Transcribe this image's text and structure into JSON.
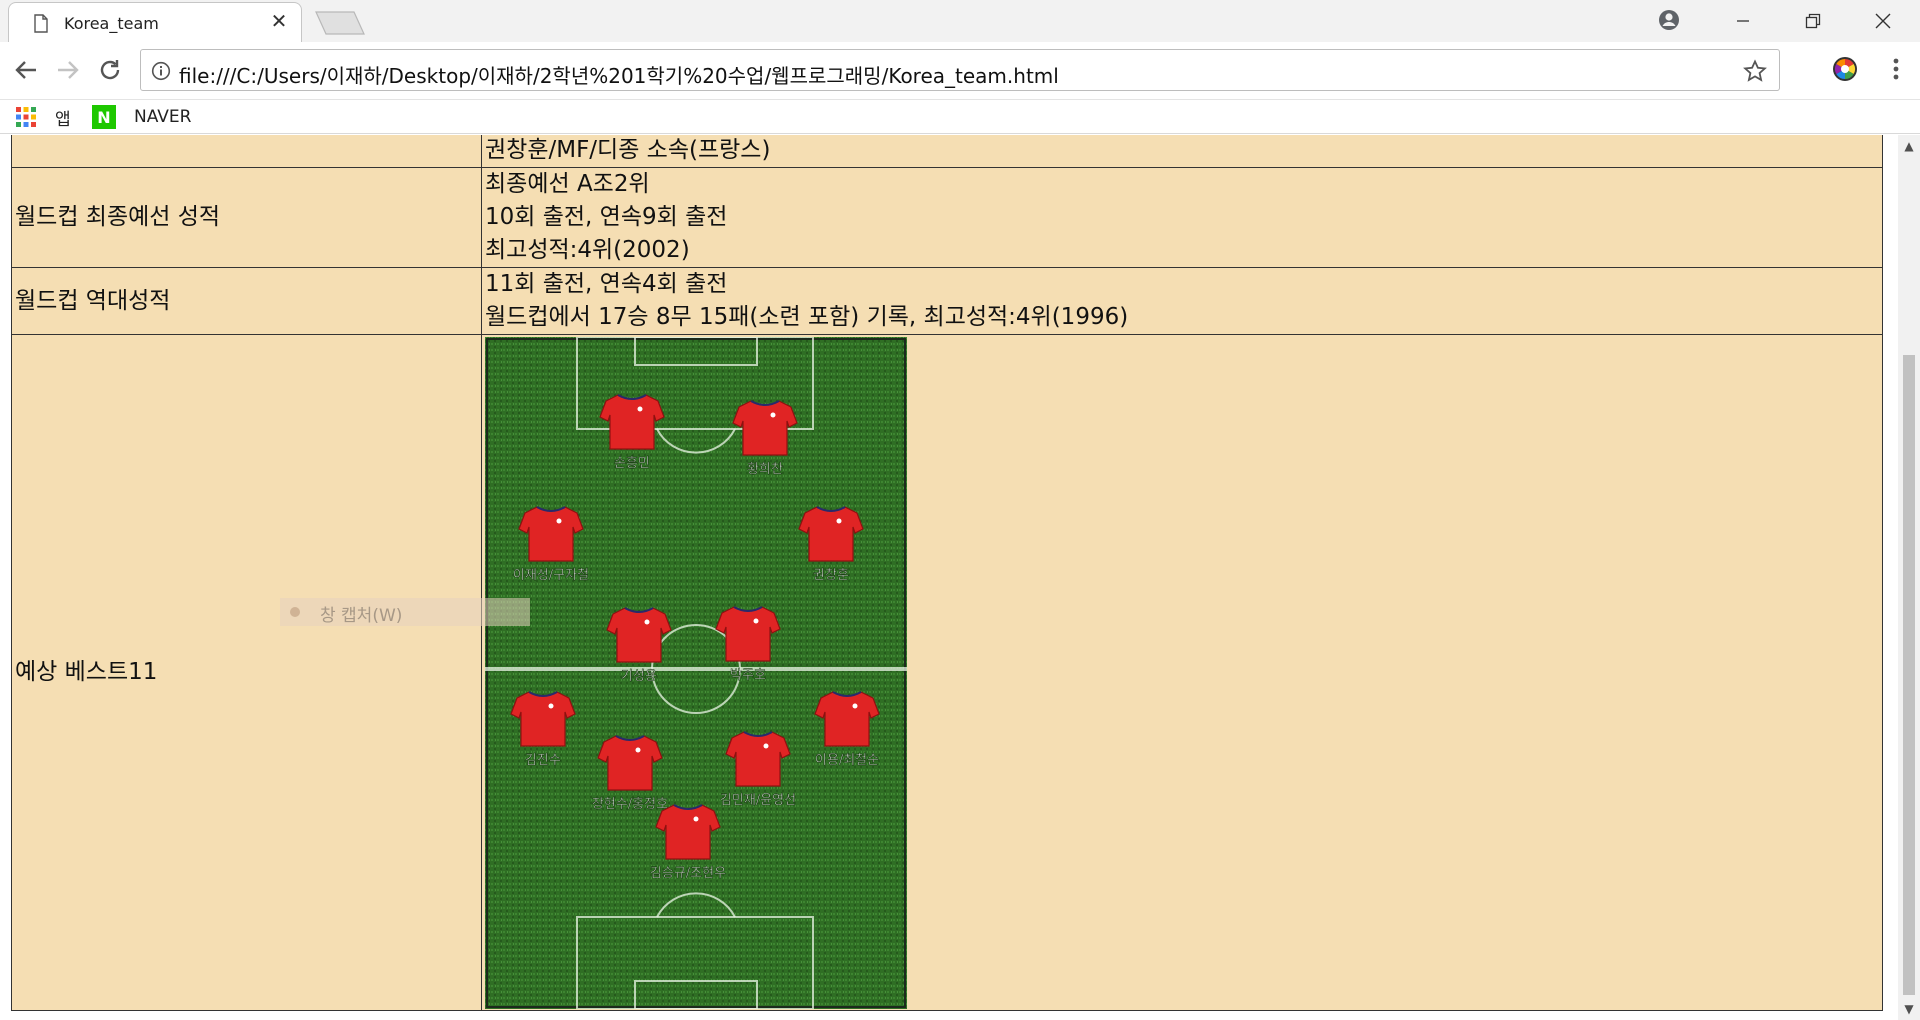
{
  "browser": {
    "tab_title": "Korea_team",
    "url": "file:///C:/Users/이재하/Desktop/이재하/2학년%201학기%20수업/웹프로그래밍/Korea_team.html",
    "bookmarks": [
      {
        "label": "앱",
        "icon": "apps-grid-icon"
      },
      {
        "label": "NAVER",
        "icon": "naver-logo",
        "logo_letter": "N"
      }
    ],
    "colors": {
      "naver_green": "#1ec800",
      "page_table_bg": "#f5deb3"
    }
  },
  "table": {
    "rows": [
      {
        "label": "",
        "lines": [
          "권창훈/MF/디종 소속(프랑스)"
        ]
      },
      {
        "label": "월드컵 최종예선 성적",
        "lines": [
          "최종예선 A조2위",
          "10회 출전, 연속9회 출전",
          "최고성적:4위(2002)"
        ]
      },
      {
        "label": "월드컵 역대성적",
        "lines": [
          "11회 출전, 연속4회 출전",
          "월드컵에서 17승 8무 15패(소련 포함) 기록, 최고성적:4위(1996)"
        ]
      },
      {
        "label": "예상 베스트11"
      }
    ]
  },
  "formation": {
    "players": [
      {
        "name": "손흥민"
      },
      {
        "name": "황희찬"
      },
      {
        "name": "이재성/구자철"
      },
      {
        "name": "권창훈"
      },
      {
        "name": "기성용"
      },
      {
        "name": "박주호"
      },
      {
        "name": "김진수"
      },
      {
        "name": "이용/최철순"
      },
      {
        "name": "장현수/홍정호"
      },
      {
        "name": "김민재/윤영선"
      },
      {
        "name": "김승규/조현우"
      }
    ]
  },
  "overlay": {
    "capture_label": "창 캡처(W)"
  }
}
